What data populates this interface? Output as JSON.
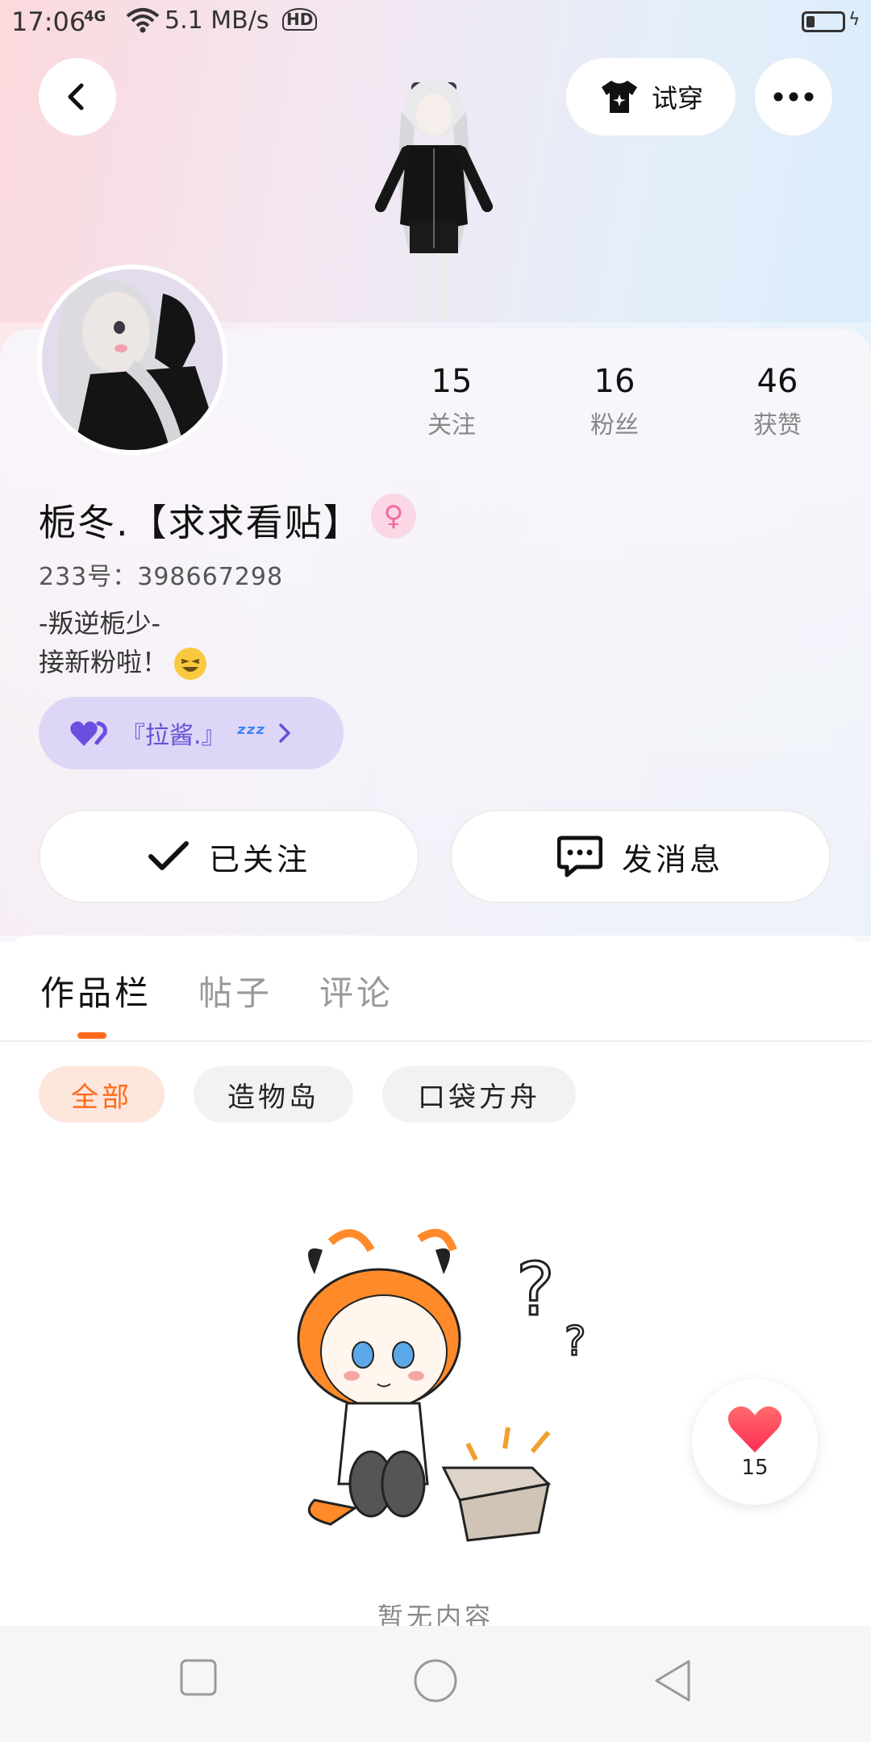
{
  "status_bar": {
    "time": "17:06",
    "network": "4G",
    "speed": "5.1 MB/s",
    "hd": "HD"
  },
  "header": {
    "back_icon": "chevron-left-icon",
    "try_on_label": "试穿",
    "try_on_icon": "tshirt-icon",
    "more_icon": "more-dots-icon"
  },
  "profile": {
    "stats": [
      {
        "value": "15",
        "label": "关注"
      },
      {
        "value": "16",
        "label": "粉丝"
      },
      {
        "value": "46",
        "label": "获赞"
      }
    ],
    "username": "栀冬.【求求看贴】",
    "gender_icon": "female-icon",
    "uid": "233号：398667298",
    "bio_line1": "-叛逆栀少-",
    "bio_line2": "接新粉啦！",
    "guard_label": "『拉酱.』",
    "guard_icon": "heart-pair-icon",
    "guard_extra_icon": "zzz-icon"
  },
  "actions": {
    "follow_label": "已关注",
    "message_label": "发消息"
  },
  "tabs": [
    {
      "label": "作品栏",
      "active": true
    },
    {
      "label": "帖子",
      "active": false
    },
    {
      "label": "评论",
      "active": false
    }
  ],
  "filters": [
    {
      "label": "全部",
      "active": true
    },
    {
      "label": "造物岛",
      "active": false
    },
    {
      "label": "口袋方舟",
      "active": false
    }
  ],
  "empty_state": {
    "text": "暂无内容"
  },
  "floating_like": {
    "count": "15"
  },
  "colors": {
    "accent": "#ff6a1a",
    "active_filter_bg": "#fde6dc",
    "inactive_filter_bg": "#f2f2f2",
    "guard_bg": "#ddd6f6",
    "guard_text": "#6650d6",
    "like_red": "#ff3b4b"
  }
}
